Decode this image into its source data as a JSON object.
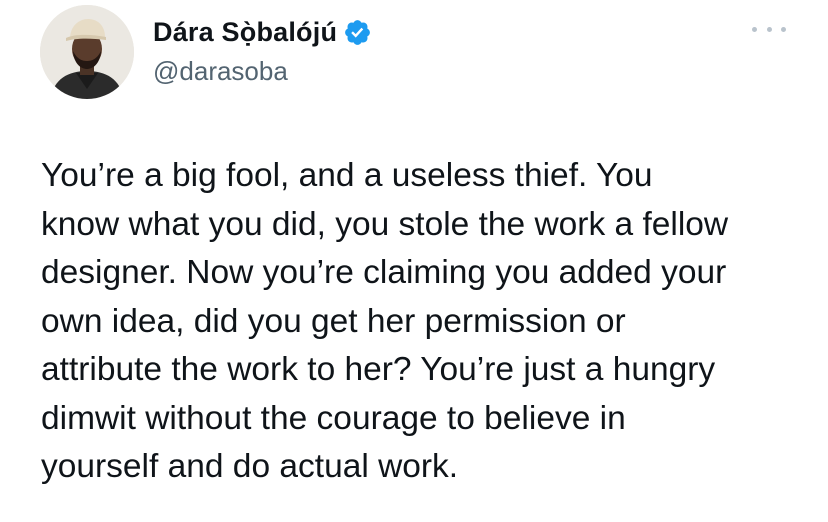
{
  "author": {
    "display_name": "Dára Sọ̀balójú",
    "handle": "@darasoba",
    "verified": true,
    "avatar_icon": "profile-photo-icon"
  },
  "tweet": {
    "text": "You’re a big fool, and a useless thief. You\nknow what you did, you stole the work a fellow\ndesigner. Now you’re claiming you added your\nown idea, did you get her permission or\nattribute the work to her? You’re just a hungry\ndimwit without the courage to believe in\nyourself and do actual work."
  },
  "icons": {
    "verified": "verified-badge-icon",
    "more": "more-options-icon"
  },
  "colors": {
    "text_primary": "#0f1419",
    "text_secondary": "#536471",
    "verified_blue": "#1d9bf0",
    "background": "#ffffff"
  }
}
